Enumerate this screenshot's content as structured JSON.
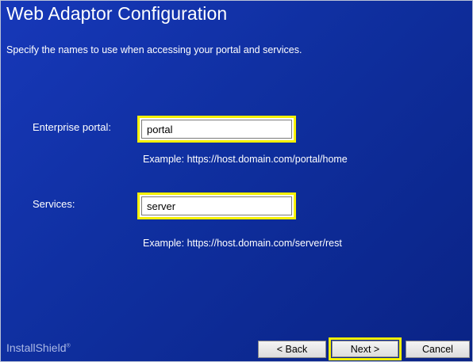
{
  "header": {
    "title": "Web Adaptor Configuration",
    "subtitle": "Specify the names to use when accessing your portal and services."
  },
  "form": {
    "portal": {
      "label": "Enterprise portal:",
      "value": "portal",
      "example": "Example: https://host.domain.com/portal/home"
    },
    "services": {
      "label": "Services:",
      "value": "server",
      "example": "Example: https://host.domain.com/server/rest"
    }
  },
  "footer": {
    "brand": "InstallShield",
    "brand_mark": "®",
    "back_label": "< Back",
    "next_label": "Next >",
    "cancel_label": "Cancel"
  },
  "colors": {
    "background": "#1234a8",
    "highlight": "#f6f000",
    "text": "#ffffff"
  }
}
